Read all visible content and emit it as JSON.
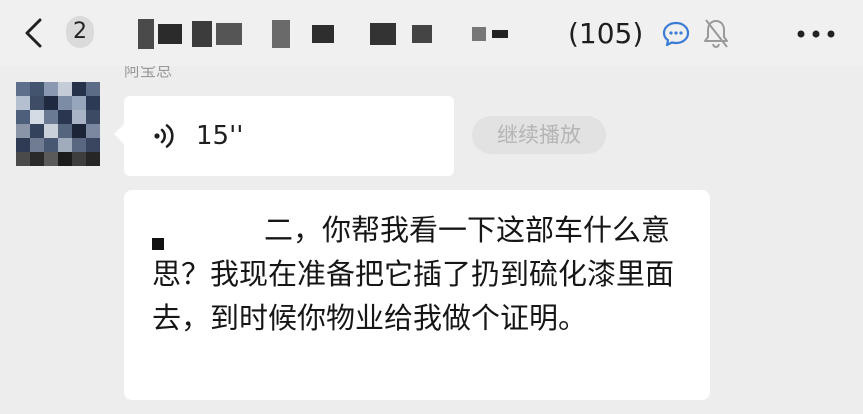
{
  "header": {
    "unread_count": "2",
    "member_count": "(105)",
    "icons": [
      "back-icon",
      "chat-bubble-icon",
      "mute-bell-icon",
      "more-icon"
    ]
  },
  "messages": [
    {
      "type": "voice",
      "sender_name": "阿宝总",
      "duration": "15''",
      "continue_label": "继续播放"
    },
    {
      "type": "text",
      "text": "二，你帮我看一下这部车什么意思？我现在准备把它插了扔到硫化漆里面去，到时候你物业给我做个证明。"
    }
  ]
}
